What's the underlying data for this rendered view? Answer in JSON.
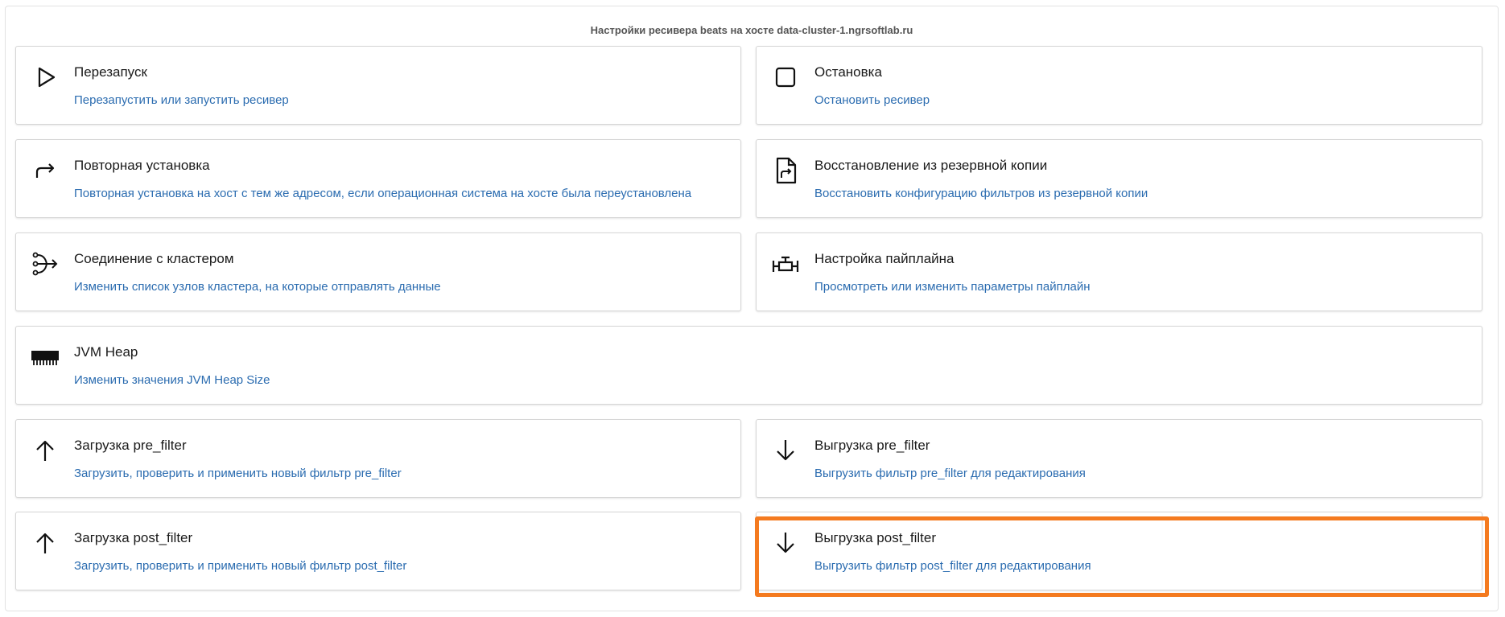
{
  "header": {
    "title": "Настройки ресивера beats на хосте data-cluster-1.ngrsoftlab.ru"
  },
  "cards": [
    {
      "icon": "play-icon",
      "title": "Перезапуск",
      "description": "Перезапустить или запустить ресивер"
    },
    {
      "icon": "stop-icon",
      "title": "Остановка",
      "description": "Остановить ресивер"
    },
    {
      "icon": "redo-arrow-icon",
      "title": "Повторная установка",
      "description": "Повторная установка на хост с тем же адресом, если операционная система на хосте была переустановлена"
    },
    {
      "icon": "file-restore-icon",
      "title": "Восстановление из резервной копии",
      "description": "Восстановить конфигурацию фильтров из резервной копии"
    },
    {
      "icon": "merge-nodes-icon",
      "title": "Соединение с кластером",
      "description": "Изменить список узлов кластера, на которые отправлять данные"
    },
    {
      "icon": "pipeline-valve-icon",
      "title": "Настройка пайплайна",
      "description": "Просмотреть или изменить параметры пайплайн"
    },
    {
      "icon": "memory-chip-icon",
      "title": "JVM Heap",
      "description": "Изменить значения JVM Heap Size"
    },
    {
      "icon": "arrow-up-icon",
      "title": "Загрузка pre_filter",
      "description": "Загрузить, проверить и применить новый фильтр pre_filter"
    },
    {
      "icon": "arrow-down-icon",
      "title": "Выгрузка pre_filter",
      "description": "Выгрузить фильтр pre_filter для редактирования"
    },
    {
      "icon": "arrow-up-icon",
      "title": "Загрузка post_filter",
      "description": "Загрузить, проверить и применить новый фильтр post_filter"
    },
    {
      "icon": "arrow-down-icon",
      "title": "Выгрузка post_filter",
      "description": "Выгрузить фильтр post_filter для редактирования"
    }
  ],
  "colors": {
    "title_text": "#1a1a1a",
    "description_link": "#2b6cb0",
    "highlight_border": "#f47a1f",
    "card_border": "#d6d6d6"
  }
}
